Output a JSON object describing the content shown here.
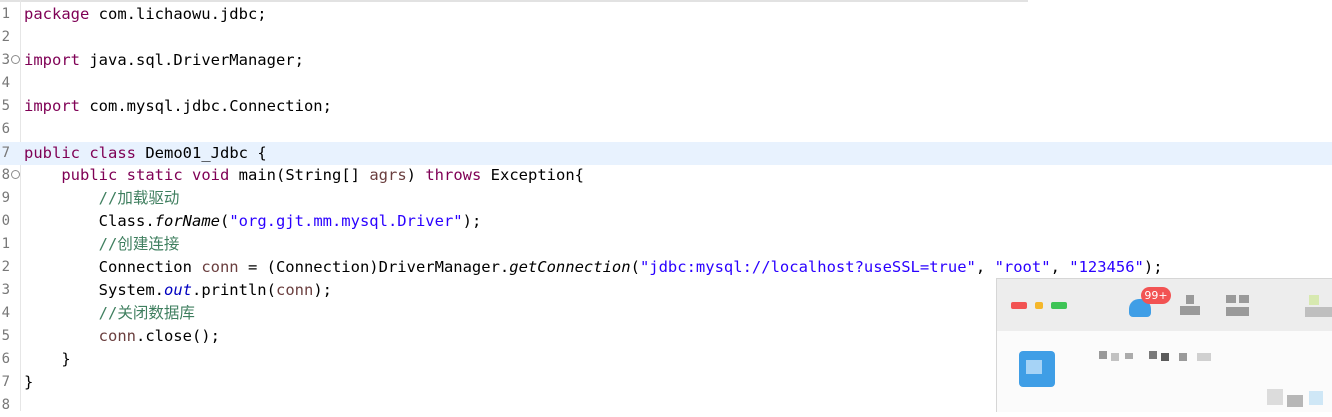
{
  "editor": {
    "lines": [
      {
        "num": "1",
        "parts": [
          {
            "t": "package",
            "c": "kw"
          },
          {
            "t": " com.lichaowu.jdbc;"
          }
        ]
      },
      {
        "num": "2",
        "parts": []
      },
      {
        "num": "3",
        "fold": "⊖",
        "parts": [
          {
            "t": "import",
            "c": "kw"
          },
          {
            "t": " java.sql.DriverManager;"
          }
        ]
      },
      {
        "num": "4",
        "parts": []
      },
      {
        "num": "5",
        "parts": [
          {
            "t": "import",
            "c": "kw"
          },
          {
            "t": " com.mysql.jdbc.Connection;"
          }
        ]
      },
      {
        "num": "6",
        "parts": []
      },
      {
        "num": "7",
        "highlight": true,
        "parts": [
          {
            "t": "public",
            "c": "kw"
          },
          {
            "t": " "
          },
          {
            "t": "class",
            "c": "kw"
          },
          {
            "t": " Demo01_Jdbc {"
          }
        ]
      },
      {
        "num": "8",
        "fold": "⊖",
        "parts": [
          {
            "t": "    "
          },
          {
            "t": "public",
            "c": "kw"
          },
          {
            "t": " "
          },
          {
            "t": "static",
            "c": "kw"
          },
          {
            "t": " "
          },
          {
            "t": "void",
            "c": "kw"
          },
          {
            "t": " main(String[] "
          },
          {
            "t": "agrs",
            "c": "vr"
          },
          {
            "t": ") "
          },
          {
            "t": "throws",
            "c": "kw"
          },
          {
            "t": " Exception{"
          }
        ]
      },
      {
        "num": "9",
        "parts": [
          {
            "t": "        "
          },
          {
            "t": "//加载驱动",
            "c": "cm"
          }
        ]
      },
      {
        "num": "0",
        "parts": [
          {
            "t": "        Class."
          },
          {
            "t": "forName",
            "c": "it"
          },
          {
            "t": "("
          },
          {
            "t": "\"org.gjt.mm.mysql.Driver\"",
            "c": "st"
          },
          {
            "t": ");"
          }
        ]
      },
      {
        "num": "1",
        "parts": [
          {
            "t": "        "
          },
          {
            "t": "//创建连接",
            "c": "cm"
          }
        ]
      },
      {
        "num": "2",
        "parts": [
          {
            "t": "        Connection "
          },
          {
            "t": "conn",
            "c": "vr"
          },
          {
            "t": " = (Connection)DriverManager."
          },
          {
            "t": "getConnection",
            "c": "it"
          },
          {
            "t": "("
          },
          {
            "t": "\"jdbc:mysql://localhost?useSSL=true\"",
            "c": "st"
          },
          {
            "t": ", "
          },
          {
            "t": "\"root\"",
            "c": "st"
          },
          {
            "t": ", "
          },
          {
            "t": "\"123456\"",
            "c": "st"
          },
          {
            "t": ");"
          }
        ]
      },
      {
        "num": "3",
        "parts": [
          {
            "t": "        System."
          },
          {
            "t": "out",
            "c": "fl"
          },
          {
            "t": ".println("
          },
          {
            "t": "conn",
            "c": "vr"
          },
          {
            "t": ");"
          }
        ]
      },
      {
        "num": "4",
        "parts": [
          {
            "t": "        "
          },
          {
            "t": "//关闭数据库",
            "c": "cm"
          }
        ]
      },
      {
        "num": "5",
        "parts": [
          {
            "t": "        "
          },
          {
            "t": "conn",
            "c": "vr"
          },
          {
            "t": ".close();"
          }
        ]
      },
      {
        "num": "6",
        "parts": [
          {
            "t": "    }"
          }
        ]
      },
      {
        "num": "7",
        "parts": [
          {
            "t": "}"
          }
        ]
      },
      {
        "num": "8",
        "parts": []
      }
    ]
  },
  "overlay": {
    "badge": "99+",
    "colors": {
      "red": "#f25353",
      "yellow": "#f5b72b",
      "green": "#3ec456",
      "blue": "#3f9ee6"
    }
  }
}
